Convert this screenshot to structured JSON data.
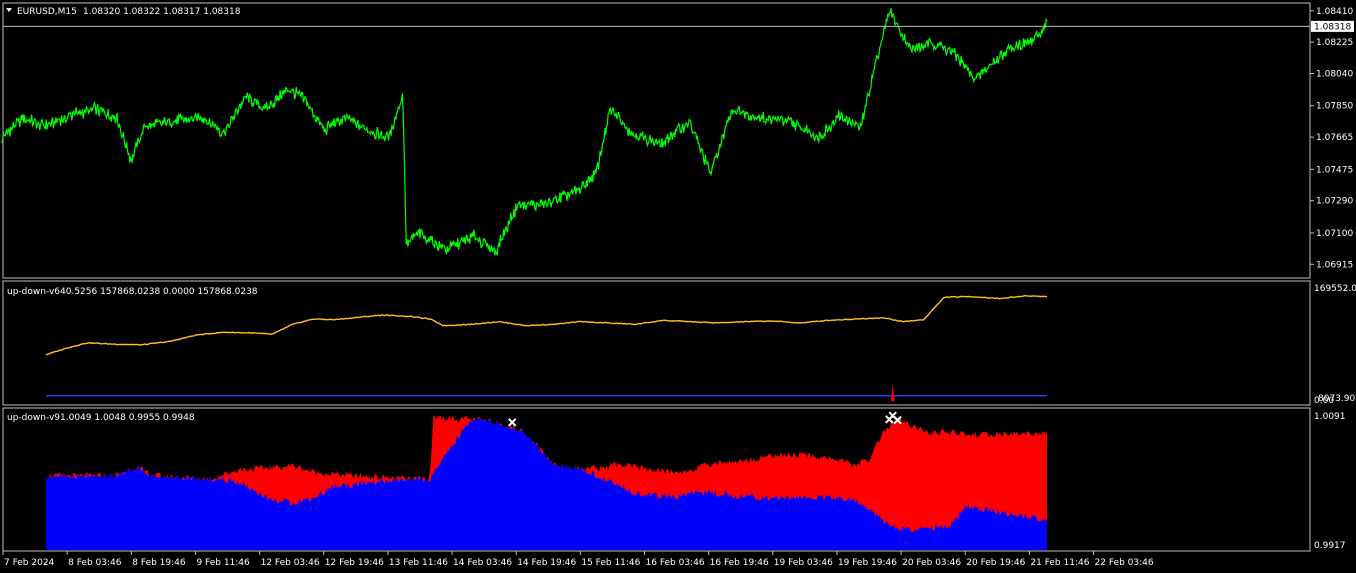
{
  "chart_data": [
    {
      "type": "line",
      "symbol": "EURUSD,M15",
      "header_values": "1.08320 1.08322 1.08317 1.08318",
      "current_price": "1.08318",
      "current_value": 1.08318,
      "ylim": [
        1.0684,
        1.0845
      ],
      "y_ticks": [
        1.0841,
        1.08225,
        1.0804,
        1.0785,
        1.07665,
        1.07475,
        1.0729,
        1.071,
        1.06915
      ],
      "y_tick_labels": [
        "1.08410",
        "1.08225",
        "1.08040",
        "1.07850",
        "1.07665",
        "1.07475",
        "1.07290",
        "1.07100",
        "1.06915"
      ],
      "line_color": "#00ff00",
      "x_range": [
        0,
        14.6
      ],
      "series": [
        {
          "x": [
            0,
            0.3,
            0.6,
            1.0,
            1.3,
            1.6,
            1.8,
            2.0,
            2.4,
            2.8,
            3.1,
            3.4,
            3.7,
            4.0,
            4.2,
            4.5,
            4.8,
            5.1,
            5.4,
            5.6,
            5.65,
            5.8,
            6.2,
            6.6,
            6.9,
            7.2,
            7.6,
            8.0,
            8.3,
            8.5,
            8.8,
            9.2,
            9.6,
            9.9,
            10.2,
            10.6,
            11.0,
            11.4,
            11.7,
            12.0,
            12.2,
            12.4,
            12.7,
            13.0,
            13.3,
            13.6,
            13.9,
            14.2,
            14.4,
            14.6
          ],
          "y": [
            1.0766,
            1.0778,
            1.0773,
            1.078,
            1.0783,
            1.0778,
            1.0753,
            1.0773,
            1.0776,
            1.0778,
            1.0769,
            1.079,
            1.0783,
            1.0795,
            1.079,
            1.0771,
            1.0778,
            1.0771,
            1.0766,
            1.0792,
            1.0702,
            1.071,
            1.07,
            1.0708,
            1.0699,
            1.0726,
            1.0727,
            1.0734,
            1.0745,
            1.0783,
            1.0769,
            1.0762,
            1.0776,
            1.0745,
            1.0783,
            1.0778,
            1.0776,
            1.0766,
            1.0779,
            1.0772,
            1.081,
            1.0841,
            1.0818,
            1.0822,
            1.0816,
            1.08,
            1.0813,
            1.0821,
            1.0823,
            1.0834
          ]
        }
      ]
    },
    {
      "type": "line",
      "indicator": "up-down-v6",
      "header_values": "40.5256 157868.0238 0.0000 157868.0238",
      "y_tick_labels": [
        "169552.08",
        "8073.908",
        "0.00"
      ],
      "ylim": [
        0,
        180000
      ],
      "series": [
        {
          "color": "#ffc020",
          "x": [
            0,
            0.3,
            0.6,
            1.0,
            1.4,
            1.8,
            2.2,
            2.6,
            3.0,
            3.3,
            3.6,
            3.9,
            4.2,
            4.5,
            4.9,
            5.3,
            5.6,
            5.8,
            6.2,
            6.6,
            7.0,
            7.4,
            7.8,
            8.2,
            8.6,
            9.0,
            9.4,
            9.8,
            10.2,
            10.6,
            11.0,
            11.4,
            11.8,
            12.2,
            12.5,
            12.8,
            13.1,
            13.5,
            13.9,
            14.3,
            14.6
          ],
          "y": [
            70000,
            80000,
            88000,
            86000,
            85000,
            90000,
            100000,
            104000,
            103000,
            101000,
            116000,
            124000,
            123000,
            126000,
            130000,
            128000,
            124000,
            114000,
            116000,
            120000,
            114000,
            116000,
            120000,
            118000,
            116000,
            122000,
            120000,
            118000,
            120000,
            121000,
            118000,
            122000,
            124000,
            126000,
            120000,
            123000,
            157000,
            158000,
            155000,
            159000,
            158000
          ]
        },
        {
          "color": "#2040ff",
          "x": [
            0,
            14.6
          ],
          "y": [
            8000,
            8000
          ]
        }
      ],
      "spike": {
        "x": 12.35,
        "y": 25000,
        "color": "#ff0000"
      }
    },
    {
      "type": "area",
      "indicator": "up-down-v9",
      "header_values": "1.0049 1.0048 0.9955 0.9948",
      "y_tick_labels": [
        "1.0091",
        "0.9917"
      ],
      "ylim": [
        0.9908,
        1.0098
      ],
      "series": [
        {
          "name": "upper",
          "color": "#ff0000",
          "x": [
            0,
            1.0,
            1.3,
            1.6,
            2.4,
            2.8,
            3.3,
            3.6,
            3.9,
            4.2,
            4.5,
            4.9,
            5.3,
            5.6,
            5.65,
            6.2,
            6.6,
            7.0,
            7.4,
            7.8,
            8.2,
            8.25,
            8.7,
            9.2,
            9.4,
            9.8,
            10.2,
            10.6,
            11.0,
            11.4,
            11.8,
            12.0,
            12.2,
            12.4,
            12.8,
            13.2,
            13.6,
            14.0,
            14.6
          ],
          "y": [
            1.0008,
            1.0008,
            1.002,
            1.0008,
            1.0004,
            1.0016,
            1.0019,
            1.0022,
            1.0013,
            1.001,
            1.0008,
            1.0006,
            1.0004,
            1.0004,
            1.0087,
            1.0084,
            1.008,
            1.0066,
            1.0024,
            1.0018,
            1.0019,
            1.0024,
            1.0018,
            1.0012,
            1.0016,
            1.0026,
            1.0028,
            1.0036,
            1.0036,
            1.0033,
            1.0022,
            1.003,
            1.0065,
            1.0084,
            1.0068,
            1.0066,
            1.0063,
            1.0064,
            1.0066
          ]
        },
        {
          "name": "lower",
          "color": "#0000ff",
          "x": [
            0,
            1.0,
            1.3,
            1.6,
            2.4,
            2.8,
            3.3,
            3.6,
            3.9,
            4.2,
            4.5,
            4.9,
            5.3,
            5.6,
            6.2,
            6.6,
            7.0,
            7.4,
            7.8,
            8.2,
            8.7,
            9.2,
            9.4,
            9.8,
            10.2,
            10.6,
            11.0,
            11.4,
            11.8,
            12.0,
            12.2,
            12.4,
            12.8,
            13.2,
            13.4,
            13.6,
            14.0,
            14.6
          ],
          "y": [
            1.0008,
            1.0008,
            1.002,
            1.0008,
            1.0004,
            1.0,
            0.9975,
            0.9972,
            0.9978,
            0.9994,
            0.9996,
            1.0,
            1.0002,
            1.0004,
            1.0084,
            1.008,
            1.0066,
            1.0024,
            1.0018,
            1.0,
            0.9982,
            0.9979,
            0.9986,
            0.9984,
            0.998,
            0.9978,
            0.9979,
            0.9978,
            0.9974,
            0.9964,
            0.9948,
            0.9936,
            0.9936,
            0.994,
            0.9967,
            0.9964,
            0.9957,
            0.9949
          ]
        }
      ],
      "markers": [
        {
          "x": 6.8,
          "y": 1.008,
          "symbol": "x",
          "color": "#ffffff"
        },
        {
          "x": 12.35,
          "y": 1.0089,
          "symbol": "x",
          "color": "#ffffff"
        },
        {
          "x": 12.3,
          "y": 1.0084,
          "symbol": "x",
          "color": "#ffffff"
        },
        {
          "x": 12.42,
          "y": 1.0083,
          "symbol": "x",
          "color": "#ffffff"
        }
      ]
    }
  ],
  "time_axis": {
    "labels": [
      "7 Feb 2024",
      "8 Feb 03:46",
      "8 Feb 19:46",
      "9 Feb 11:46",
      "12 Feb 03:46",
      "12 Feb 19:46",
      "13 Feb 11:46",
      "14 Feb 03:46",
      "14 Feb 19:46",
      "15 Feb 11:46",
      "16 Feb 03:46",
      "16 Feb 19:46",
      "19 Feb 03:46",
      "19 Feb 19:46",
      "20 Feb 03:46",
      "20 Feb 19:46",
      "21 Feb 11:46",
      "22 Feb 03:46"
    ]
  }
}
